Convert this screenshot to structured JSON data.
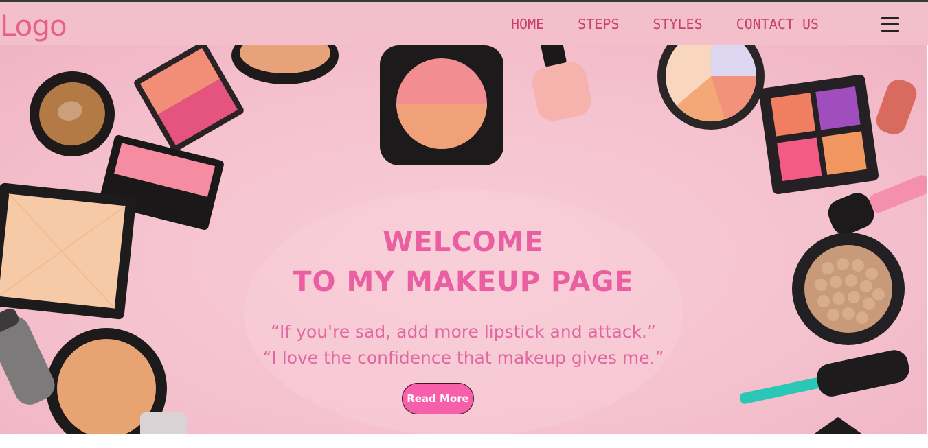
{
  "header": {
    "logo": "Logo",
    "nav": [
      {
        "label": "HOME"
      },
      {
        "label": "STEPS"
      },
      {
        "label": "STYLES"
      },
      {
        "label": "CONTACT US"
      }
    ],
    "menu_icon": "hamburger-menu-icon"
  },
  "hero": {
    "title_line1": "WELCOME",
    "title_line2": "TO MY MAKEUP PAGE",
    "quote1": "“If you're sad, add more lipstick and attack.”",
    "quote2": "“I love the confidence that makeup gives me.”",
    "button_label": "Read More"
  },
  "colors": {
    "navbar": "#f2bfcb",
    "accent": "#ea5fa2",
    "button": "#f75fab",
    "hero_bg": "#f5c2cf"
  }
}
